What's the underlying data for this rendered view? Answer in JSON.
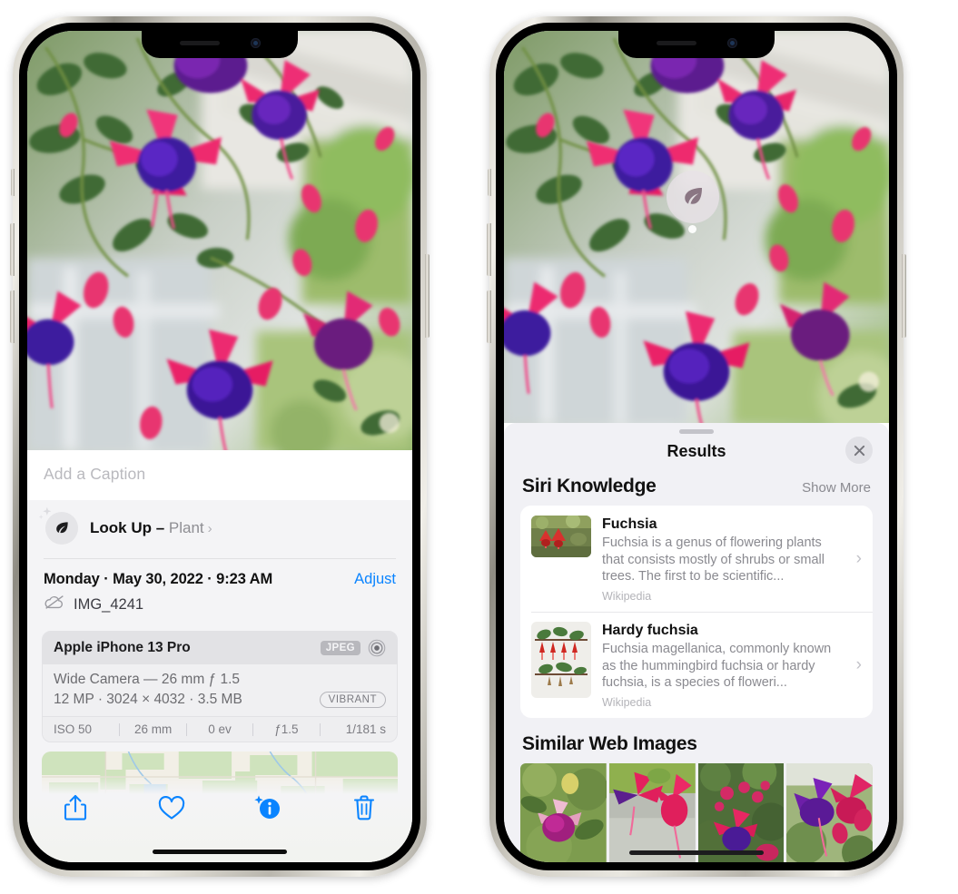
{
  "left_phone": {
    "caption_placeholder": "Add a Caption",
    "lookup": {
      "label_bold": "Look Up – ",
      "label_subject": "Plant",
      "chevron": "›",
      "icon": "leaf-icon"
    },
    "meta": {
      "date": "Monday · May 30, 2022 · 9:23 AM",
      "adjust_label": "Adjust",
      "filename": "IMG_4241",
      "cloud_icon": "cloud-slash-icon"
    },
    "exif": {
      "device": "Apple iPhone 13 Pro",
      "format_badge": "JPEG",
      "lens_icon": "aperture-icon",
      "lens_line": "Wide Camera — 26 mm ƒ 1.5",
      "size_line": "12 MP · 3024 × 4032 · 3.5 MB",
      "profile_badge": "VIBRANT",
      "stats": [
        "ISO 50",
        "26 mm",
        "0 ev",
        "ƒ1.5",
        "1/181 s"
      ]
    },
    "toolbar": [
      {
        "name": "share-button",
        "icon": "share-icon",
        "active": false
      },
      {
        "name": "favorite-button",
        "icon": "heart-icon",
        "active": false
      },
      {
        "name": "info-button",
        "icon": "info-sparkle-icon",
        "active": true
      },
      {
        "name": "delete-button",
        "icon": "trash-icon",
        "active": false
      }
    ]
  },
  "right_phone": {
    "visual_lookup_badge": {
      "icon": "leaf-icon"
    },
    "sheet": {
      "title": "Results",
      "close_icon": "close-icon"
    },
    "siri_knowledge": {
      "section_title": "Siri Knowledge",
      "show_more": "Show More",
      "results": [
        {
          "title": "Fuchsia",
          "description": "Fuchsia is a genus of flowering plants that consists mostly of shrubs or small trees. The first to be scientific...",
          "source": "Wikipedia",
          "chevron": "›"
        },
        {
          "title": "Hardy fuchsia",
          "description": "Fuchsia magellanica, commonly known as the hummingbird fuchsia or hardy fuchsia, is a species of floweri...",
          "source": "Wikipedia",
          "chevron": "›"
        }
      ]
    },
    "similar_web_images": {
      "section_title": "Similar Web Images",
      "count": 4
    }
  },
  "colors": {
    "accent_blue": "#0a84ff",
    "sheet_bg": "#f1f1f5",
    "panel_bg": "#f4f4f6",
    "card_white": "#ffffff",
    "secondary_text": "#8a8a90"
  }
}
